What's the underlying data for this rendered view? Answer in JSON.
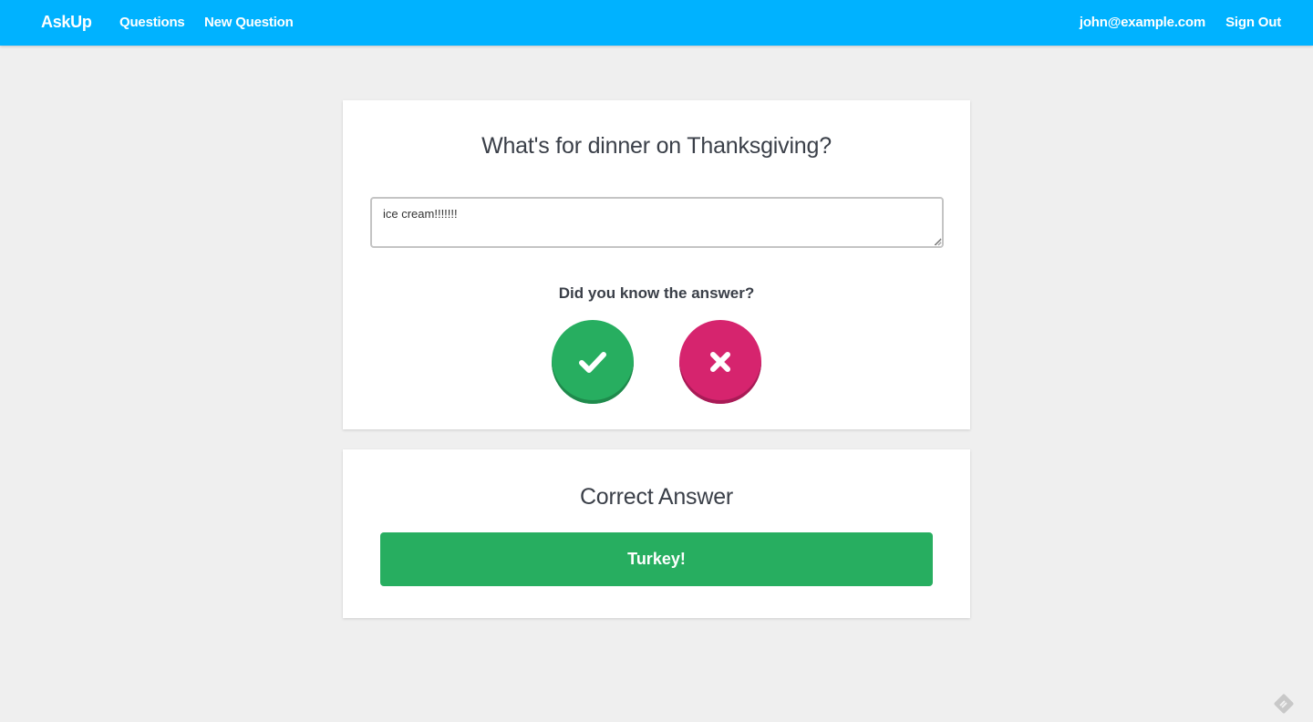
{
  "nav": {
    "brand": "AskUp",
    "links": [
      "Questions",
      "New Question"
    ],
    "user_email": "john@example.com",
    "sign_out": "Sign Out"
  },
  "question": {
    "title": "What's for dinner on Thanksgiving?",
    "answer_value": "ice cream!!!!!!!",
    "prompt": "Did you know the answer?",
    "yes_icon": "checkmark-icon",
    "no_icon": "close-icon"
  },
  "correct": {
    "title": "Correct Answer",
    "answer": "Turkey!"
  },
  "colors": {
    "navbar": "#00b2ff",
    "success": "#27ae60",
    "danger": "#d6246e",
    "background": "#efefef"
  }
}
